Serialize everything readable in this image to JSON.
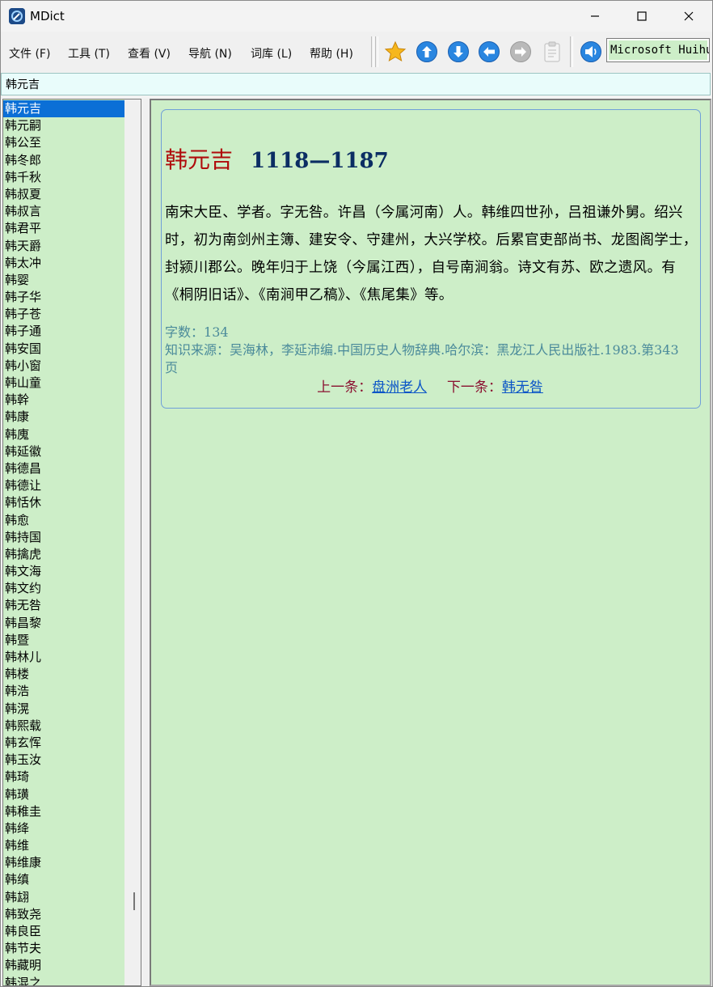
{
  "window": {
    "title": "MDict"
  },
  "menu": [
    {
      "id": "file",
      "label": "文件 (F)"
    },
    {
      "id": "tools",
      "label": "工具 (T)"
    },
    {
      "id": "view",
      "label": "查看 (V)"
    },
    {
      "id": "nav",
      "label": "导航 (N)"
    },
    {
      "id": "library",
      "label": "词库 (L)"
    },
    {
      "id": "help",
      "label": "帮助 (H)"
    }
  ],
  "toolbar": {
    "icons": [
      "star-icon",
      "arrow-up-icon",
      "arrow-down-icon",
      "arrow-left-icon",
      "arrow-right-icon",
      "clipboard-icon",
      "speaker-icon"
    ],
    "font_name": "Microsoft Huihui"
  },
  "search": {
    "value": "韩元吉"
  },
  "word_list": {
    "selected_index": 0,
    "items": [
      "韩元吉",
      "韩元嗣",
      "韩公至",
      "韩冬郎",
      "韩千秋",
      "韩叔夏",
      "韩叔言",
      "韩君平",
      "韩天爵",
      "韩太冲",
      "韩婴",
      "韩子华",
      "韩子苍",
      "韩子通",
      "韩安国",
      "韩小窗",
      "韩山童",
      "韩幹",
      "韩康",
      "韩廆",
      "韩延徽",
      "韩德昌",
      "韩德让",
      "韩恬休",
      "韩愈",
      "韩持国",
      "韩擒虎",
      "韩文海",
      "韩文约",
      "韩无咎",
      "韩昌黎",
      "韩暨",
      "韩林儿",
      "韩楼",
      "韩浩",
      "韩滉",
      "韩熙载",
      "韩玄恽",
      "韩玉汝",
      "韩琦",
      "韩璜",
      "韩稚圭",
      "韩绛",
      "韩维",
      "韩维康",
      "韩缜",
      "韩翃",
      "韩致尧",
      "韩良臣",
      "韩节夫",
      "韩藏明",
      "韩混之"
    ]
  },
  "entry": {
    "name": "韩元吉",
    "years": "1118—1187",
    "body": "南宋大臣、学者。字无咎。许昌（今属河南）人。韩维四世孙，吕祖谦外舅。绍兴时，初为南剑州主簿、建安令、守建州，大兴学校。后累官吏部尚书、龙图阁学士，封颍川郡公。晚年归于上饶（今属江西），自号南涧翁。诗文有苏、欧之遗风。有《桐阴旧话》、《南涧甲乙稿》、《焦尾集》等。",
    "word_count_label": "字数：",
    "word_count": "134",
    "source_label": "知识来源：",
    "source": "吴海林，李延沛编.中国历史人物辞典.哈尔滨：黑龙江人民出版社.1983.第343页",
    "prev_label": "上一条：",
    "prev_link": "盘洲老人",
    "next_label": "下一条：",
    "next_link": "韩无咎"
  }
}
